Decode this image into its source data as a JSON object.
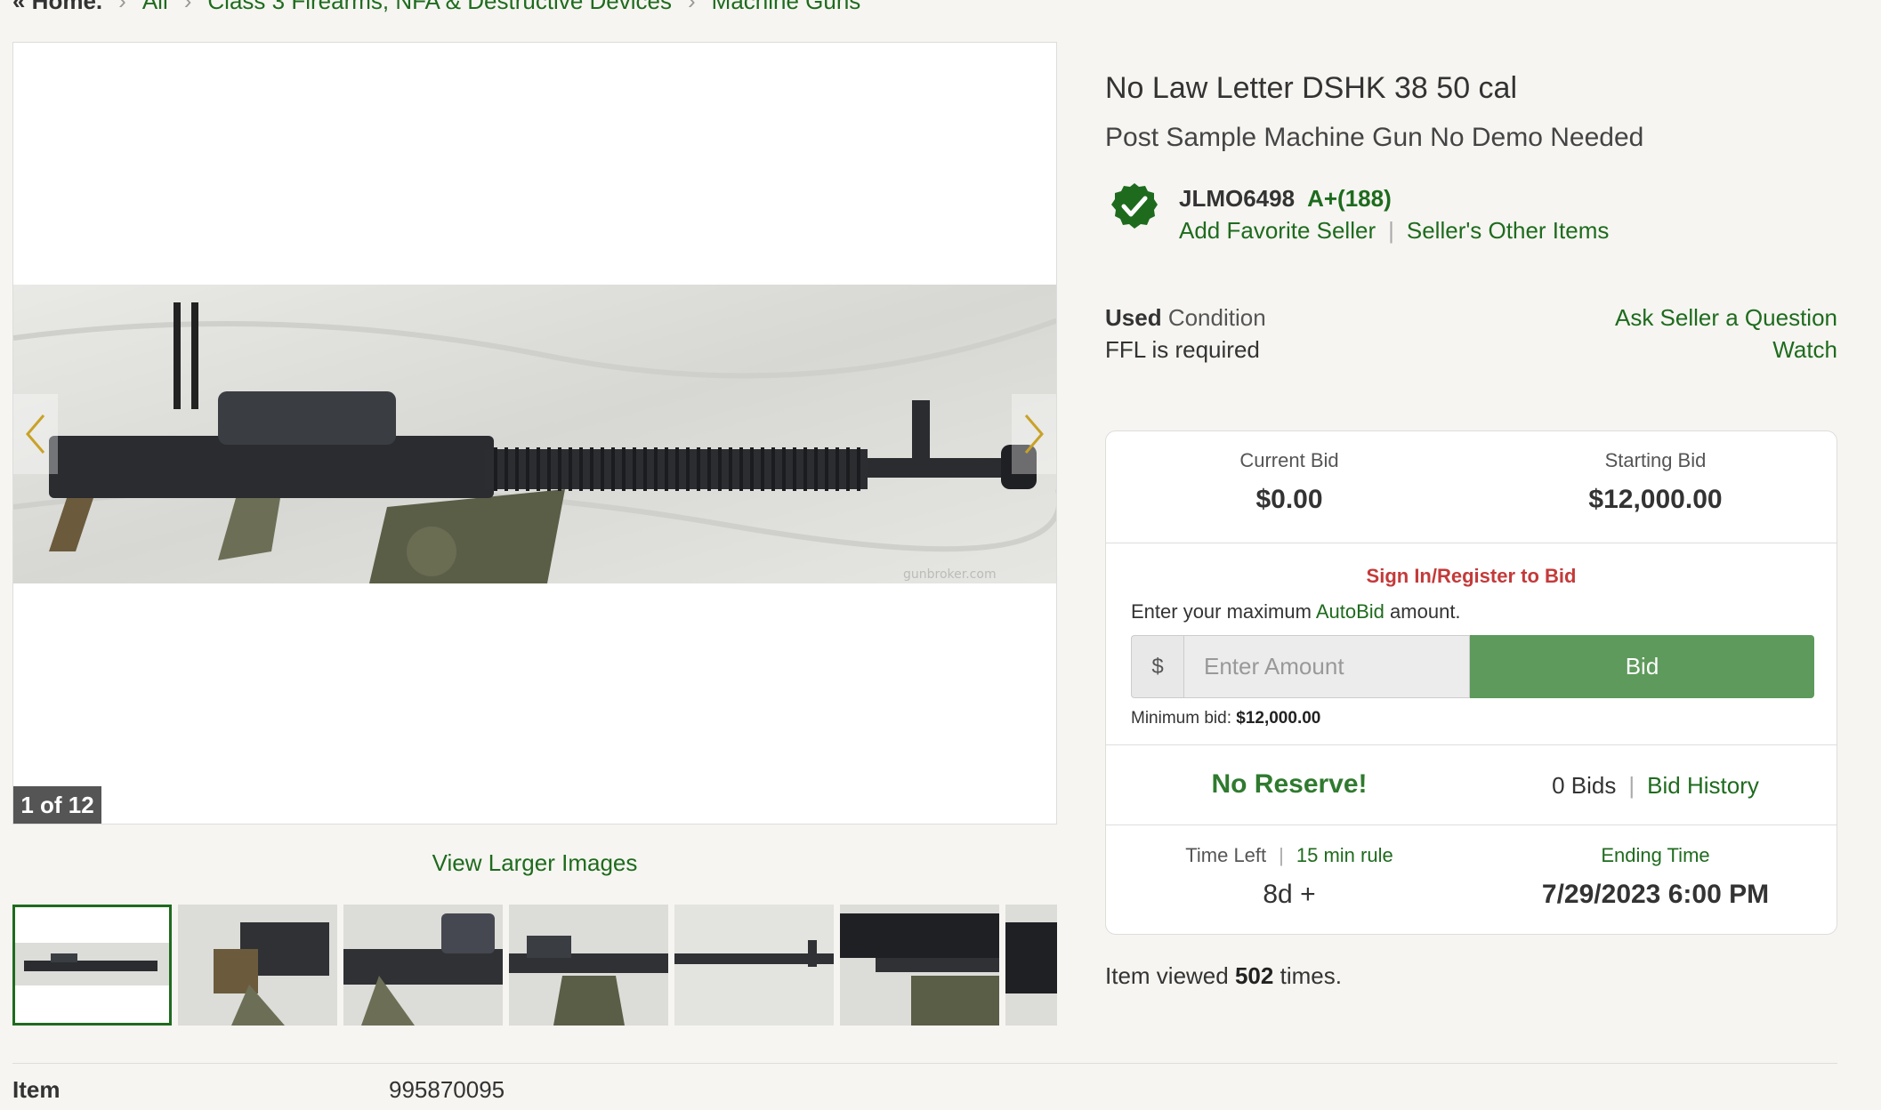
{
  "breadcrumb": {
    "home": "« Home.",
    "items": [
      "All",
      "Class 3 Firearms, NFA & Destructive Devices",
      "Machine Guns"
    ]
  },
  "gallery": {
    "counter": "1 of 12",
    "view_larger": "View Larger Images",
    "watermark": "gunbroker.com"
  },
  "listing": {
    "title": "No Law Letter DSHK 38 50 cal",
    "subtitle": "Post Sample Machine Gun No Demo Needed"
  },
  "seller": {
    "name": "JLMO6498",
    "rating": "A+(188)",
    "add_favorite": "Add Favorite Seller",
    "other_items": "Seller's Other Items"
  },
  "details": {
    "condition_value": "Used",
    "condition_label": "Condition",
    "ffl": "FFL is required",
    "ask_question": "Ask Seller a Question",
    "watch": "Watch"
  },
  "bid": {
    "current_bid_label": "Current Bid",
    "current_bid": "$0.00",
    "starting_bid_label": "Starting Bid",
    "starting_bid": "$12,000.00",
    "signin": "Sign In/Register to Bid",
    "enter_max_prefix": "Enter your maximum",
    "autobid": "AutoBid",
    "enter_max_suffix": "amount.",
    "currency": "$",
    "amount_placeholder": "Enter Amount",
    "bid_button": "Bid",
    "min_bid_label": "Minimum bid:",
    "min_bid_value": "$12,000.00",
    "no_reserve": "No Reserve!",
    "bids_count": "0 Bids",
    "bid_history": "Bid History",
    "time_left_label": "Time Left",
    "rule_link": "15 min rule",
    "time_left": "8d +",
    "ending_time_label": "Ending Time",
    "ending_time": "7/29/2023 6:00 PM"
  },
  "stats": {
    "viewed_prefix": "Item viewed",
    "viewed_count": "502",
    "viewed_suffix": "times."
  },
  "item": {
    "label": "Item",
    "number": "995870095"
  },
  "colors": {
    "accent_green": "#1e6b1e",
    "bid_button": "#5d9a5b",
    "signin_red": "#c43a3a",
    "background": "#f6f5f1"
  }
}
